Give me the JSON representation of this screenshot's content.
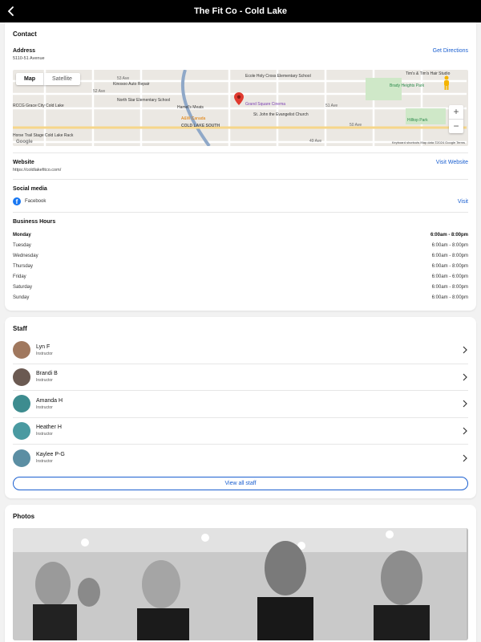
{
  "header": {
    "title": "The Fit Co - Cold Lake"
  },
  "contact": {
    "title": "Contact",
    "address_label": "Address",
    "address_value": "5110-51 Avenue",
    "directions_link": "Get Directions",
    "map": {
      "toggle_map": "Map",
      "toggle_satellite": "Satellite",
      "zoom_in": "+",
      "zoom_out": "−",
      "google": "Google",
      "footer": "Keyboard shortcuts   Map data ©2024 Google   Terms",
      "labels": {
        "poi_1": "Ecole Holy Cross Elementary School",
        "poi_2": "Kinosoo Auto Repair",
        "poi_3": "North Star Elementary School",
        "poi_4": "Hamel's Meats",
        "poi_5": "A&W Canada",
        "poi_6": "Grand Square Cinema",
        "poi_7": "St. John the Evangelist Church",
        "poi_8": "Hilltop Park",
        "poi_9": "Brady Heights Park",
        "poi_10": "Tim's & Tim's Hair Studio",
        "poi_11": "RCCG Grace City Cold Lake",
        "poi_12": "Horse Trail Stage Cold Lake Rack",
        "area": "COLD LAKE SOUTH",
        "st_1": "53 Ave",
        "st_2": "52 Ave",
        "st_3": "51 Ave",
        "st_4": "50 Ave",
        "st_5": "49 Ave"
      }
    },
    "website_label": "Website",
    "website_value": "https://coldlakefitco.com/",
    "website_link": "Visit Website",
    "social_label": "Social media",
    "facebook_label": "Facebook",
    "facebook_icon": "f",
    "facebook_link": "Visit",
    "hours_label": "Business Hours",
    "hours": [
      {
        "day": "Monday",
        "time": "6:00am - 8:00pm"
      },
      {
        "day": "Tuesday",
        "time": "6:00am - 8:00pm"
      },
      {
        "day": "Wednesday",
        "time": "6:00am - 8:00pm"
      },
      {
        "day": "Thursday",
        "time": "6:00am - 8:00pm"
      },
      {
        "day": "Friday",
        "time": "6:00am - 6:00pm"
      },
      {
        "day": "Saturday",
        "time": "6:00am - 8:00pm"
      },
      {
        "day": "Sunday",
        "time": "6:00am - 8:00pm"
      }
    ]
  },
  "staff": {
    "title": "Staff",
    "members": [
      {
        "name": "Lyn F",
        "role": "Instructor",
        "avatar_color": "#a0785e"
      },
      {
        "name": "Brandi B",
        "role": "Instructor",
        "avatar_color": "#6b5a52"
      },
      {
        "name": "Amanda H",
        "role": "Instructor",
        "avatar_color": "#3d8c8f"
      },
      {
        "name": "Heather H",
        "role": "Instructor",
        "avatar_color": "#4a9aa1"
      },
      {
        "name": "Kaylee P-G",
        "role": "Instructor",
        "avatar_color": "#5b8ea3"
      }
    ],
    "view_all": "View all staff"
  },
  "photos": {
    "title": "Photos"
  },
  "colors": {
    "accent": "#1a5fd0",
    "facebook": "#1877f2"
  }
}
